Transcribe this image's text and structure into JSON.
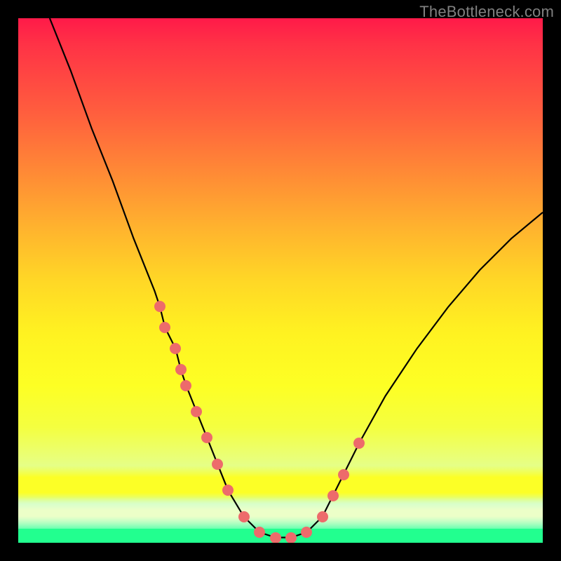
{
  "watermark": "TheBottleneck.com",
  "colors": {
    "dot": "#ed6b6b",
    "curve": "#000000",
    "background_top": "#ff1a49",
    "background_bottom": "#22ff8f"
  },
  "chart_data": {
    "type": "line",
    "title": "",
    "xlabel": "",
    "ylabel": "",
    "xlim": [
      0,
      100
    ],
    "ylim": [
      0,
      100
    ],
    "series": [
      {
        "name": "bottleneck-curve",
        "x": [
          6,
          10,
          14,
          18,
          22,
          26,
          27,
          28,
          30,
          31,
          32,
          34,
          36,
          38,
          40,
          43,
          46,
          49,
          52,
          55,
          58,
          60,
          62,
          65,
          70,
          76,
          82,
          88,
          94,
          100
        ],
        "y": [
          100,
          90,
          79,
          69,
          58,
          48,
          45,
          41,
          37,
          33,
          30,
          25,
          20,
          15,
          10,
          5,
          2,
          1,
          1,
          2,
          5,
          9,
          13,
          19,
          28,
          37,
          45,
          52,
          58,
          63
        ]
      }
    ],
    "markers": {
      "name": "highlight-dots",
      "x": [
        27,
        28,
        30,
        31,
        32,
        34,
        36,
        38,
        40,
        43,
        46,
        49,
        52,
        55,
        58,
        60,
        62,
        65
      ],
      "y": [
        45,
        41,
        37,
        33,
        30,
        25,
        20,
        15,
        10,
        5,
        2,
        1,
        1,
        2,
        5,
        9,
        13,
        19
      ]
    },
    "green_zone_y_threshold": 4
  }
}
